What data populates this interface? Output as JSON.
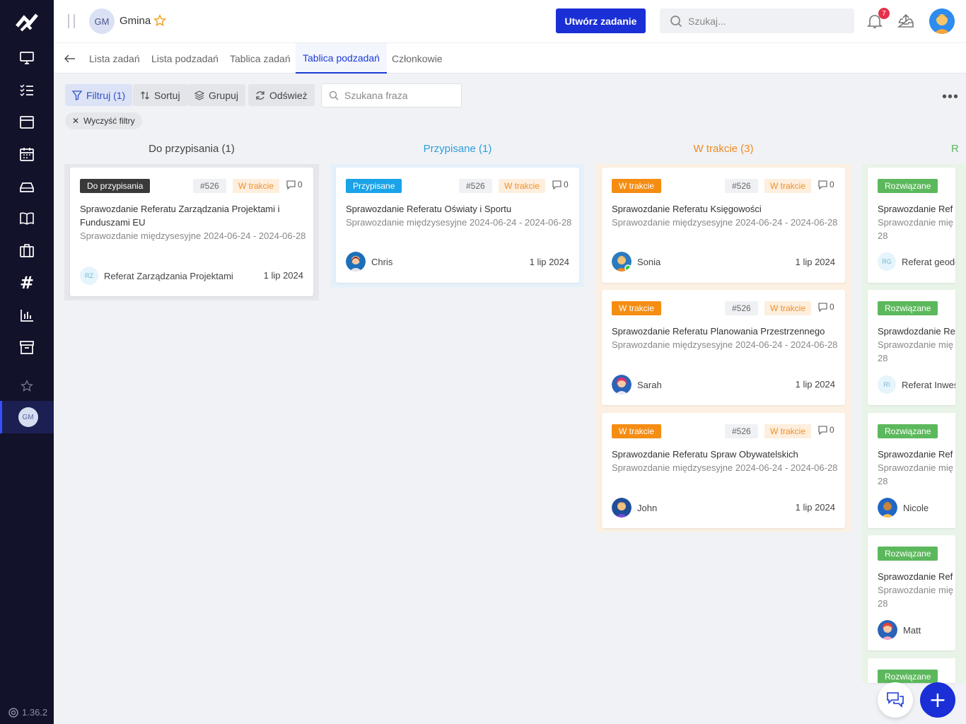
{
  "app": {
    "version": "1.36.2",
    "workspace": {
      "initials": "GM",
      "name": "Gmina"
    },
    "create_button": "Utwórz zadanie",
    "search_placeholder": "Szukaj...",
    "notifications_count": "7"
  },
  "sidebar": {
    "icons": [
      "dashboard-icon",
      "task-list-icon",
      "browser-window-icon",
      "calendar-icon",
      "inbox-tray-icon",
      "book-icon",
      "briefcase-icon",
      "hashtag-icon",
      "bar-chart-icon",
      "archive-icon",
      "star-icon"
    ],
    "active_workspace_initials": "GM"
  },
  "tabs": [
    {
      "label": "Lista zadań",
      "active": false
    },
    {
      "label": "Lista podzadań",
      "active": false
    },
    {
      "label": "Tablica zadań",
      "active": false
    },
    {
      "label": "Tablica podzadań",
      "active": true
    },
    {
      "label": "Członkowie",
      "active": false
    }
  ],
  "toolbar": {
    "filter": "Filtruj (1)",
    "sort": "Sortuj",
    "group": "Grupuj",
    "refresh": "Odśwież",
    "phrase_placeholder": "Szukana fraza",
    "clear_filters": "Wyczyść filtry"
  },
  "columns": [
    {
      "title": "Do przypisania (1)",
      "color": "#444444",
      "cards": [
        {
          "status": "Do przypisania",
          "status_color": "#3a3a3a",
          "id": "#526",
          "state": "W trakcie",
          "comments": "0",
          "title": "Sprawozdanie Referatu Zarządzania Projektami i Funduszami EU",
          "subtitle": "Sprawozdanie międzysesyjne 2024-06-24 - 2024-06-28",
          "assignee_initials": "RZ",
          "assignee": "Referat Zarządzania Projektami",
          "date": "1 lip 2024"
        }
      ]
    },
    {
      "title": "Przypisane (1)",
      "color": "#2b9fe0",
      "cards": [
        {
          "status": "Przypisane",
          "status_color": "#1aa3e8",
          "id": "#526",
          "state": "W trakcie",
          "comments": "0",
          "title": "Sprawozdanie Referatu Oświaty i Sportu",
          "subtitle": "Sprawozdanie międzysesyjne 2024-06-24 - 2024-06-28",
          "assignee": "Chris",
          "date": "1 lip 2024"
        }
      ]
    },
    {
      "title": "W trakcie (3)",
      "color": "#f08a24",
      "cards": [
        {
          "status": "W trakcie",
          "status_color": "#f58d13",
          "id": "#526",
          "state": "W trakcie",
          "comments": "0",
          "title": "Sprawozdanie Referatu Księgowości",
          "subtitle": "Sprawozdanie międzysesyjne 2024-06-24 - 2024-06-28",
          "assignee": "Sonia",
          "date": "1 lip 2024"
        },
        {
          "status": "W trakcie",
          "status_color": "#f58d13",
          "id": "#526",
          "state": "W trakcie",
          "comments": "0",
          "title": "Sprawozdanie Referatu Planowania Przestrzennego",
          "subtitle": "Sprawozdanie międzysesyjne 2024-06-24 - 2024-06-28",
          "assignee": "Sarah",
          "date": "1 lip 2024"
        },
        {
          "status": "W trakcie",
          "status_color": "#f58d13",
          "id": "#526",
          "state": "W trakcie",
          "comments": "0",
          "title": "Sprawozdanie Referatu Spraw Obywatelskich",
          "subtitle": "Sprawozdanie międzysesyjne 2024-06-24 - 2024-06-28",
          "assignee": "John",
          "date": "1 lip 2024"
        }
      ]
    },
    {
      "title": "R",
      "color": "#5cb85c",
      "cards": [
        {
          "status": "Rozwiązane",
          "status_color": "#5cb85c",
          "title": "Sprawozdanie Ref",
          "subtitle_1": "Sprawozdanie mię",
          "subtitle_2": "28",
          "assignee_initials": "RG",
          "assignee": "Referat geode"
        },
        {
          "status": "Rozwiązane",
          "status_color": "#5cb85c",
          "title": "Sprawdozdanie Re",
          "subtitle_1": "Sprawozdanie mię",
          "subtitle_2": "28",
          "assignee_initials": "RI",
          "assignee": "Referat Inwes"
        },
        {
          "status": "Rozwiązane",
          "status_color": "#5cb85c",
          "title": "Sprawozdanie Ref",
          "subtitle_1": "Sprawozdanie mię",
          "subtitle_2": "28",
          "assignee": "Nicole"
        },
        {
          "status": "Rozwiązane",
          "status_color": "#5cb85c",
          "title": "Sprawozdanie Ref",
          "subtitle_1": "Sprawozdanie mię",
          "subtitle_2": "28",
          "assignee": "Matt"
        },
        {
          "status": "Rozwiązane",
          "status_color": "#5cb85c"
        }
      ]
    }
  ]
}
